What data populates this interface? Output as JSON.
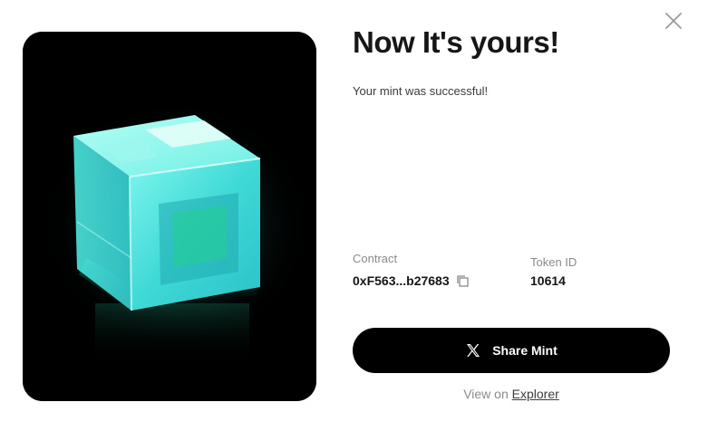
{
  "dialog": {
    "title": "Now It's yours!",
    "subtitle": "Your mint was successful!",
    "close_icon": "close-icon"
  },
  "nft": {
    "image_description_icon": "glowing-cube-image",
    "accent_color": "#3fe0d0"
  },
  "details": {
    "contract_label": "Contract",
    "contract_value": "0xF563...b27683",
    "token_label": "Token ID",
    "token_value": "10614",
    "copy_icon": "copy-icon"
  },
  "actions": {
    "share_label": "Share Mint",
    "share_icon": "x-logo-icon",
    "view_on_text": "View on",
    "explorer_link": "Explorer"
  },
  "colors": {
    "button_bg": "#000000",
    "button_text": "#ffffff",
    "muted_text": "#8a8a8a"
  }
}
